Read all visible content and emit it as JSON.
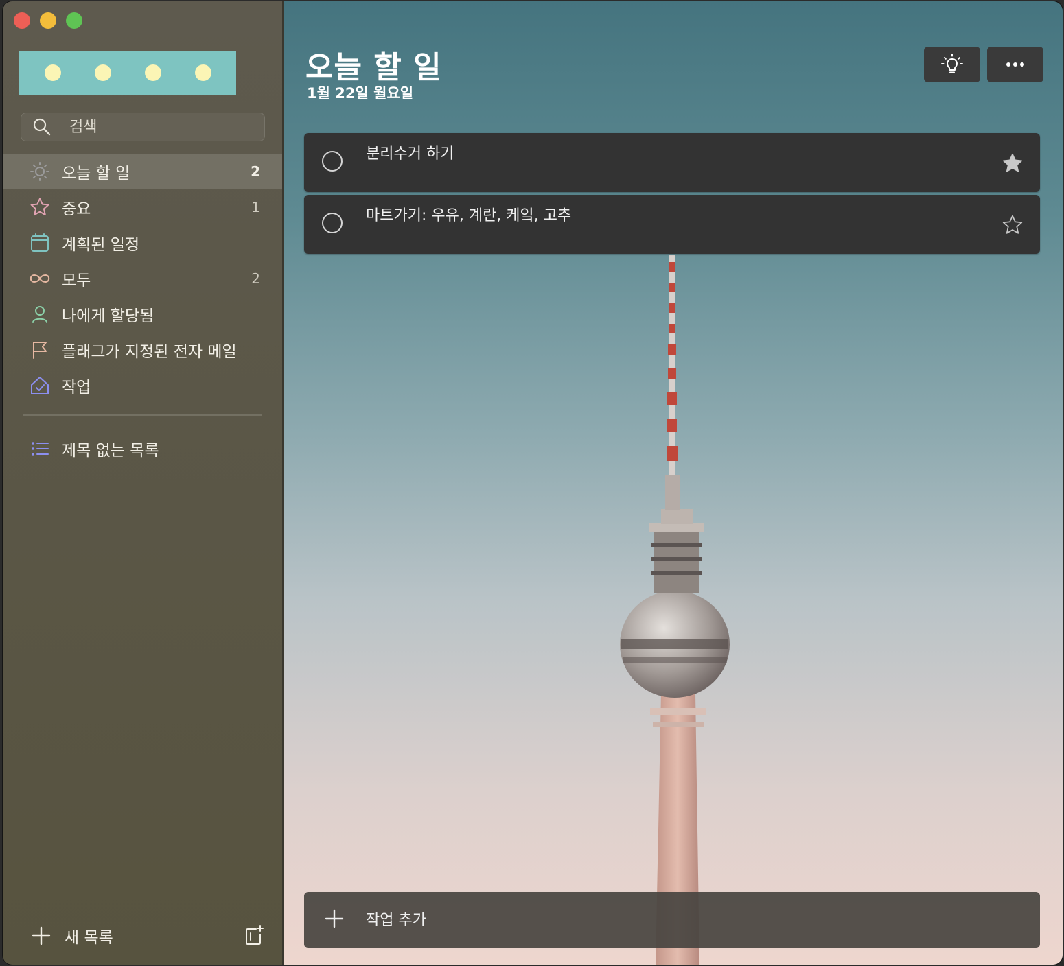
{
  "sidebar": {
    "search_placeholder": "검색",
    "items": [
      {
        "label": "오늘 할 일",
        "count": "2"
      },
      {
        "label": "중요",
        "count": "1"
      },
      {
        "label": "계획된 일정",
        "count": ""
      },
      {
        "label": "모두",
        "count": "2"
      },
      {
        "label": "나에게 할당됨",
        "count": ""
      },
      {
        "label": "플래그가 지정된 전자 메일",
        "count": ""
      },
      {
        "label": "작업",
        "count": ""
      }
    ],
    "lists": [
      {
        "label": "제목 없는 목록"
      }
    ],
    "new_list_label": "새 목록"
  },
  "main": {
    "title": "오늘 할 일",
    "date": "1월 22일 월요일",
    "tasks": [
      {
        "text": "분리수거 하기",
        "important": true
      },
      {
        "text": "마트가기: 우유, 계란, 케잌, 고추",
        "important": false
      }
    ],
    "add_task_placeholder": "작업 추가"
  },
  "colors": {
    "sidebar_bg": "#5b5749",
    "banner": "#7ec4c1",
    "banner_dots": "#fbf5b5",
    "task_bg": "#333333",
    "icon_today": "#9a9a9a",
    "icon_important": "#e1a3b2",
    "icon_planned": "#7fc3c0",
    "icon_all": "#e6b8a2",
    "icon_assigned": "#8bd0a8",
    "icon_flagged": "#e6b8a2",
    "icon_tasks": "#8c8ff0",
    "icon_list": "#8c8ff0"
  }
}
